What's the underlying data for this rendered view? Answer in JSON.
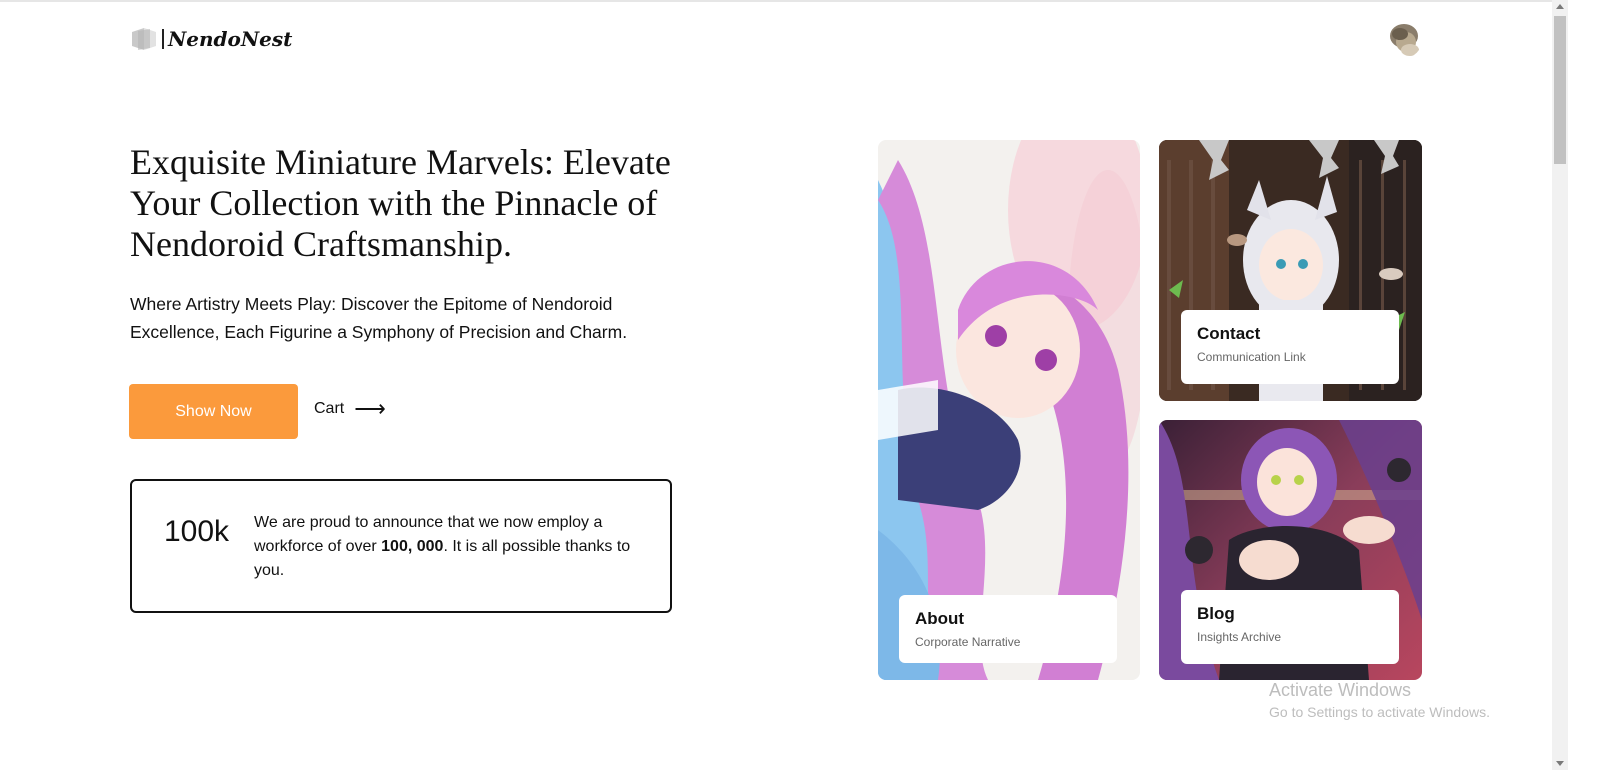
{
  "brand": {
    "name": "NendoNest"
  },
  "hero": {
    "title": "Exquisite Miniature Marvels: Elevate Your Collection with the Pinnacle of Nendoroid Craftsmanship.",
    "subtitle": "Where Artistry Meets Play: Discover the Epitome of Nendoroid Excellence, Each Figurine a Symphony of Precision and Charm.",
    "primary_button": "Show Now",
    "cart_link": "Cart",
    "cart_arrow": "⟶"
  },
  "stat": {
    "number": "100k",
    "text_before": "We are proud to announce that we now employ a workforce of over ",
    "text_bold": "100, 000",
    "text_after": ". It is all possible thanks to you."
  },
  "cards": {
    "about": {
      "title": "About",
      "desc": "Corporate Narrative"
    },
    "contact": {
      "title": "Contact",
      "desc": "Communication Link"
    },
    "blog": {
      "title": "Blog",
      "desc": "Insights Archive"
    }
  },
  "watermark": {
    "line1": "Activate Windows",
    "line2": "Go to Settings to activate Windows."
  },
  "colors": {
    "accent": "#fb9a3c",
    "text": "#111111",
    "muted": "#666666"
  }
}
